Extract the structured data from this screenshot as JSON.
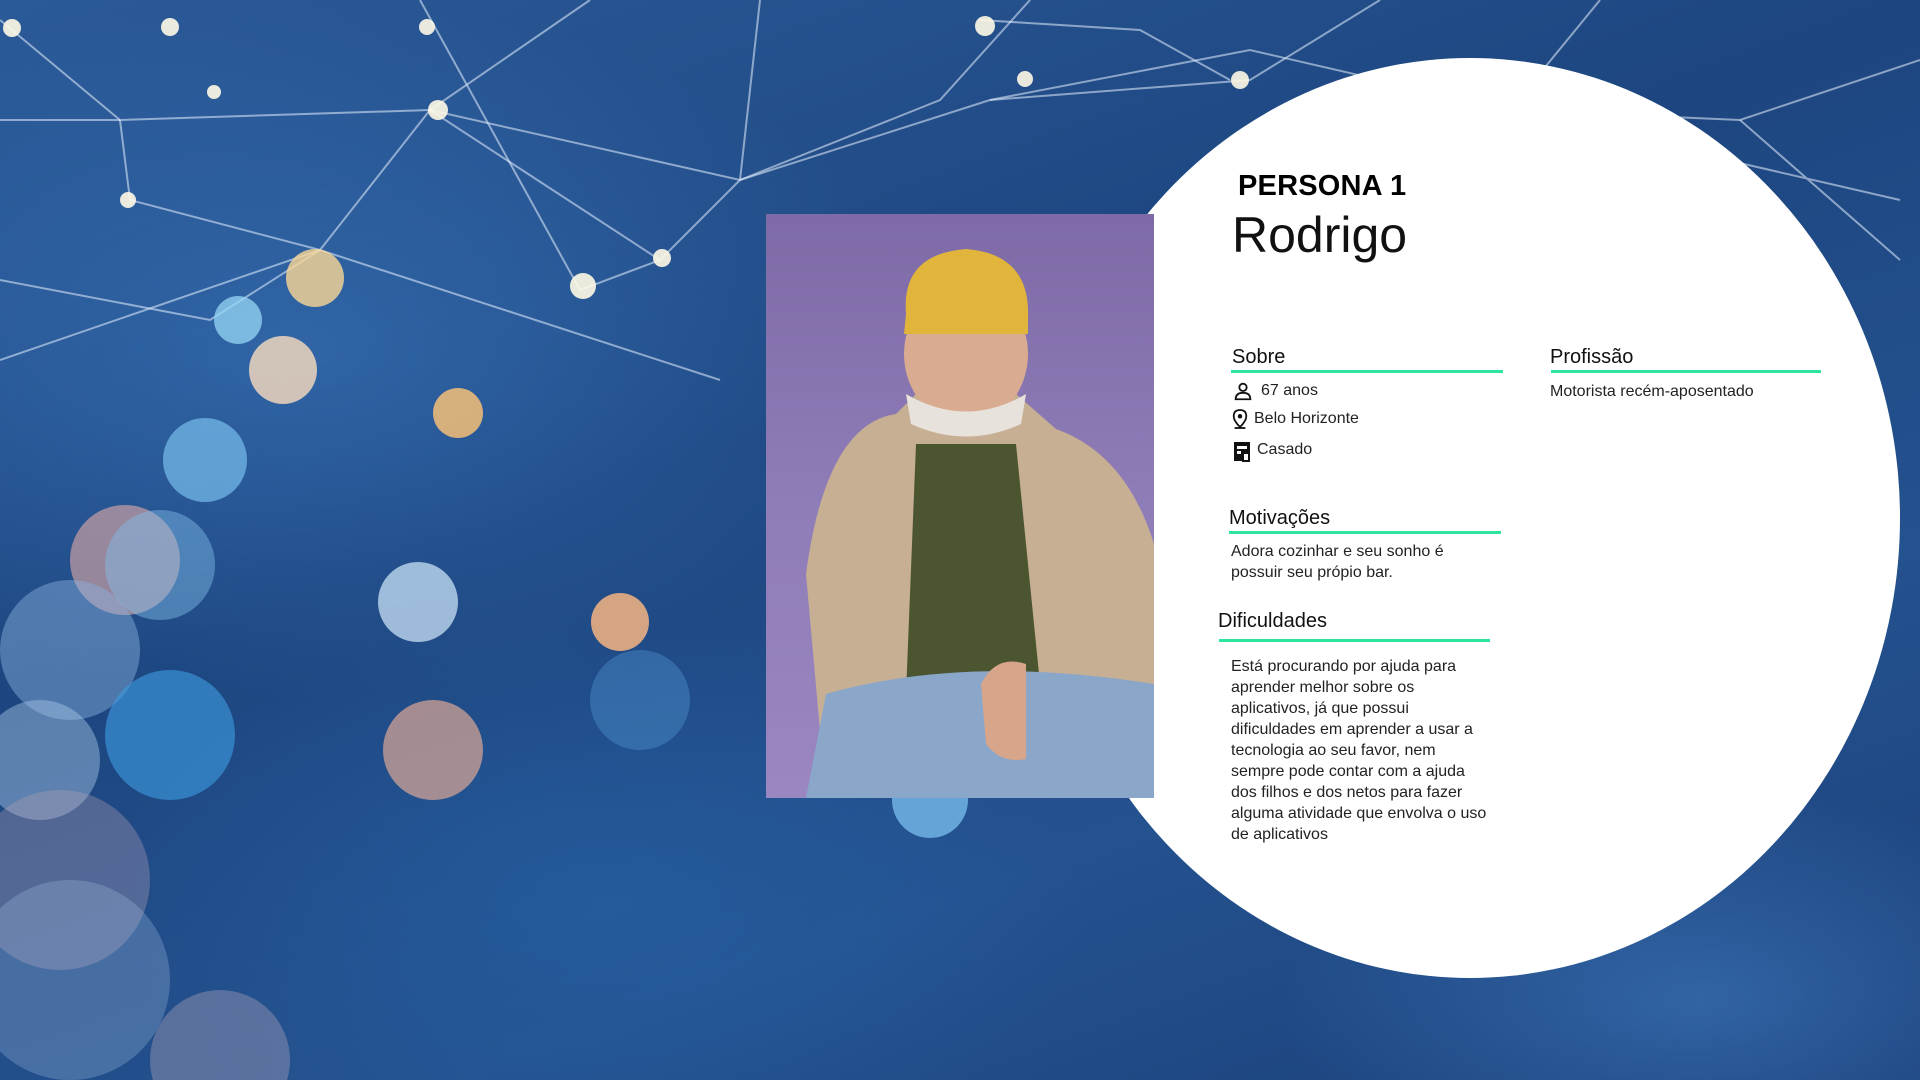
{
  "persona": {
    "tag": "PERSONA 1",
    "name": "Rodrigo"
  },
  "sobre": {
    "title": "Sobre",
    "items": [
      {
        "icon": "person-icon",
        "text": "67 anos"
      },
      {
        "icon": "location-pin-icon",
        "text": "Belo Horizonte"
      },
      {
        "icon": "building-icon",
        "text": "Casado"
      }
    ]
  },
  "profissao": {
    "title": "Profissão",
    "text": "Motorista recém-aposentado"
  },
  "motivacoes": {
    "title": "Motivações",
    "text": "Adora cozinhar e seu sonho é possuir seu própio bar."
  },
  "dificuldades": {
    "title": "Dificuldades",
    "text": "Está procurando por ajuda para aprender melhor sobre os aplicativos, já que possui dificuldades em aprender a usar a tecnologia ao seu favor, nem sempre pode contar com a ajuda dos filhos e dos netos para fazer alguma atividade que envolva o uso de aplicativos"
  },
  "colors": {
    "accent": "#2ee59d",
    "background": "#1f4a86",
    "card": "#ffffff"
  }
}
